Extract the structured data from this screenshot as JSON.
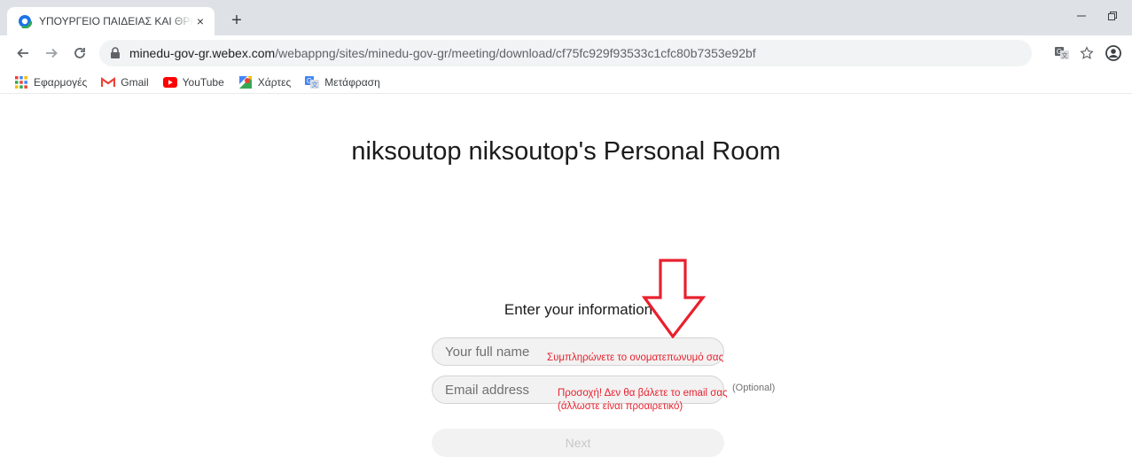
{
  "browser": {
    "tab": {
      "title": "ΥΠΟΥΡΓΕΙΟ ΠΑΙΔΕΙΑΣ ΚΑΙ ΘΡΗΣΚ",
      "close": "×"
    },
    "new_tab": "+",
    "url": {
      "host": "minedu-gov-gr.webex.com",
      "path": "/webappng/sites/minedu-gov-gr/meeting/download/cf75fc929f93533c1cfc80b7353e92bf"
    },
    "bookmarks": [
      {
        "label": "Εφαρμογές",
        "icon": "apps-grid-icon"
      },
      {
        "label": "Gmail",
        "icon": "gmail-icon"
      },
      {
        "label": "YouTube",
        "icon": "youtube-icon"
      },
      {
        "label": "Χάρτες",
        "icon": "maps-icon"
      },
      {
        "label": "Μετάφραση",
        "icon": "translate-icon"
      }
    ]
  },
  "page": {
    "room_title": "niksoutop niksoutop's Personal Room",
    "form": {
      "heading": "Enter your information",
      "name_placeholder": "Your full name",
      "email_placeholder": "Email address",
      "optional_label": "(Optional)",
      "next_label": "Next"
    },
    "annotations": {
      "name_note": "Συμπληρώνετε το ονοματεπωνυμό σας",
      "email_note_line1": "Προσοχή! Δεν θα βάλετε το email σας",
      "email_note_line2": "(άλλωστε είναι προαιρετικό)",
      "color": "#e8212e"
    }
  }
}
